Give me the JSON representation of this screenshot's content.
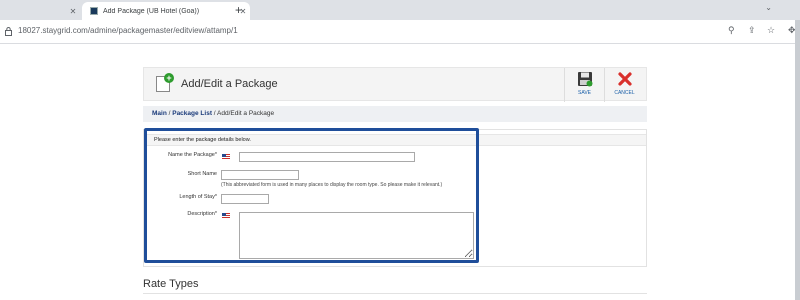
{
  "browser": {
    "tabs": [
      {
        "label": ""
      },
      {
        "label": "Add Package (UB Hotel (Goa))"
      }
    ],
    "new_tab": "+",
    "url": "18027.staygrid.com/admine/packagemaster/editview/attamp/1"
  },
  "header": {
    "title": "Add/Edit a Package",
    "save_label": "SAVE",
    "cancel_label": "CANCEL"
  },
  "breadcrumb": {
    "main": "Main",
    "sep1": " / ",
    "list": "Package List",
    "sep2": " / ",
    "current": "Add/Edit a Package"
  },
  "form": {
    "instruction": "Please enter the package details below.",
    "name_label": "Name the Package*",
    "name_value": "",
    "short_label": "Short Name",
    "short_value": "",
    "short_hint": "(This abbreviated form is used in many places to display the room type. So please make it relevant.)",
    "length_label": "Length of Stay*",
    "length_value": "",
    "description_label": "Description*",
    "description_value": ""
  },
  "section": {
    "rate_types": "Rate Types"
  },
  "colors": {
    "highlight": "#1f4e9a",
    "link": "#1a3a7a",
    "save_icon": "#2e9c2e",
    "cancel_icon": "#d9302c"
  }
}
